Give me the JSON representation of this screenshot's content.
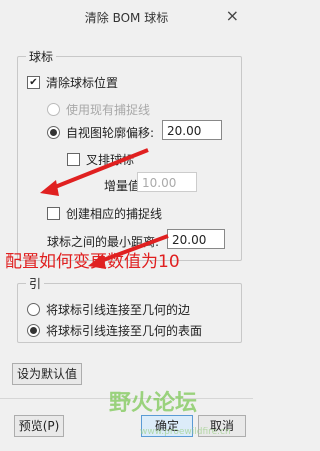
{
  "window": {
    "title": "清除 BOM 球标",
    "close_glyph": "×"
  },
  "group1": {
    "title": "球标",
    "clear_balloon_pos": {
      "label": "清除球标位置",
      "checked": true
    },
    "use_existing_snap": {
      "label": "使用现有捕捉线",
      "enabled": false
    },
    "offset_from_outline": {
      "label": "自视图轮廓偏移:",
      "value": "20.00",
      "selected": true
    },
    "stagger": {
      "label": "叉排球标",
      "checked": false
    },
    "increment": {
      "label": "增量值:",
      "value": "10.00"
    },
    "create_snap_lines": {
      "label": "创建相应的捕捉线",
      "checked": false
    },
    "min_distance": {
      "label": "球标之间的最小距离:",
      "value": "20.00"
    }
  },
  "annotation": {
    "text": "配置如何变更数值为10",
    "color": "#e02020"
  },
  "group2": {
    "title": "引",
    "leader_to_edge": {
      "label": "将球标引线连接至几何的边",
      "selected": false
    },
    "leader_to_surface": {
      "label": "将球标引线连接至几何的表面",
      "selected": true
    }
  },
  "buttons": {
    "set_default": "设为默认值",
    "preview": "预览(P)",
    "ok": "确定",
    "cancel": "取消"
  },
  "watermark": {
    "text": "野火论坛",
    "url": "www.proewildfire.cn"
  }
}
